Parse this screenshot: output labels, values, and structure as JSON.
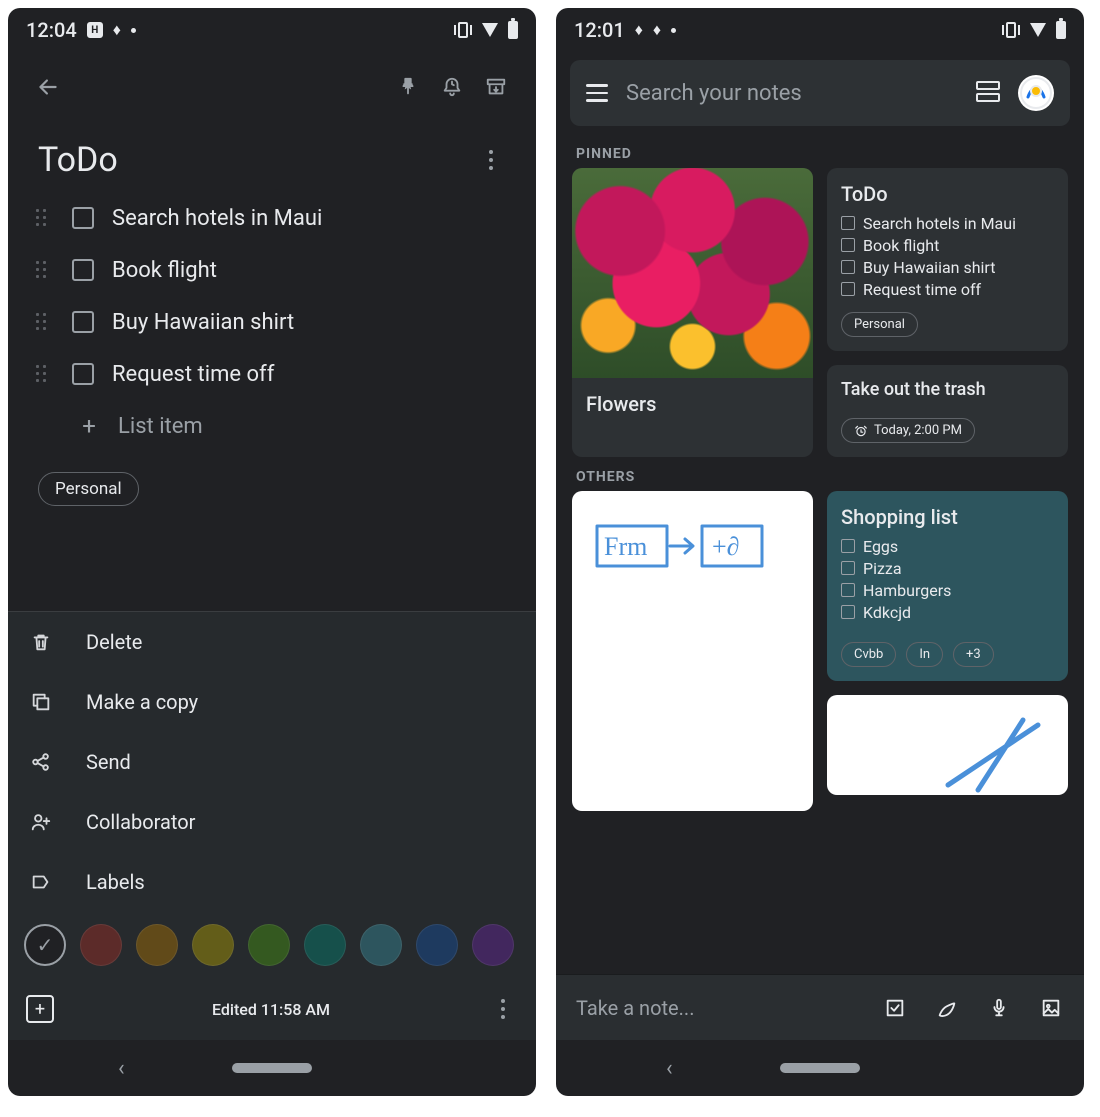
{
  "left": {
    "status_time": "12:04",
    "note_title": "ToDo",
    "items": [
      "Search hotels in Maui",
      "Book flight",
      "Buy Hawaiian shirt",
      "Request time off"
    ],
    "add_item_placeholder": "List item",
    "label_chip": "Personal",
    "sheet": {
      "delete": "Delete",
      "copy": "Make a copy",
      "send": "Send",
      "collaborator": "Collaborator",
      "labels": "Labels"
    },
    "colors": [
      "#202124",
      "#5c2b29",
      "#614a19",
      "#635d19",
      "#345920",
      "#16504b",
      "#2d555e",
      "#1e3a5f",
      "#42275e"
    ],
    "edited_text": "Edited 11:58 AM"
  },
  "right": {
    "status_time": "12:01",
    "search_placeholder": "Search your notes",
    "section_pinned": "PINNED",
    "section_others": "OTHERS",
    "flowers_title": "Flowers",
    "todo": {
      "title": "ToDo",
      "items": [
        "Search hotels in Maui",
        "Book flight",
        "Buy Hawaiian shirt",
        "Request time off"
      ],
      "chip": "Personal"
    },
    "trash": {
      "title": "Take out the trash",
      "reminder": "Today, 2:00 PM"
    },
    "shopping": {
      "title": "Shopping list",
      "items": [
        "Eggs",
        "Pizza",
        "Hamburgers",
        "Kdkcjd"
      ],
      "chips": [
        "Cvbb",
        "In",
        "+3"
      ]
    },
    "take_note_placeholder": "Take a note..."
  }
}
